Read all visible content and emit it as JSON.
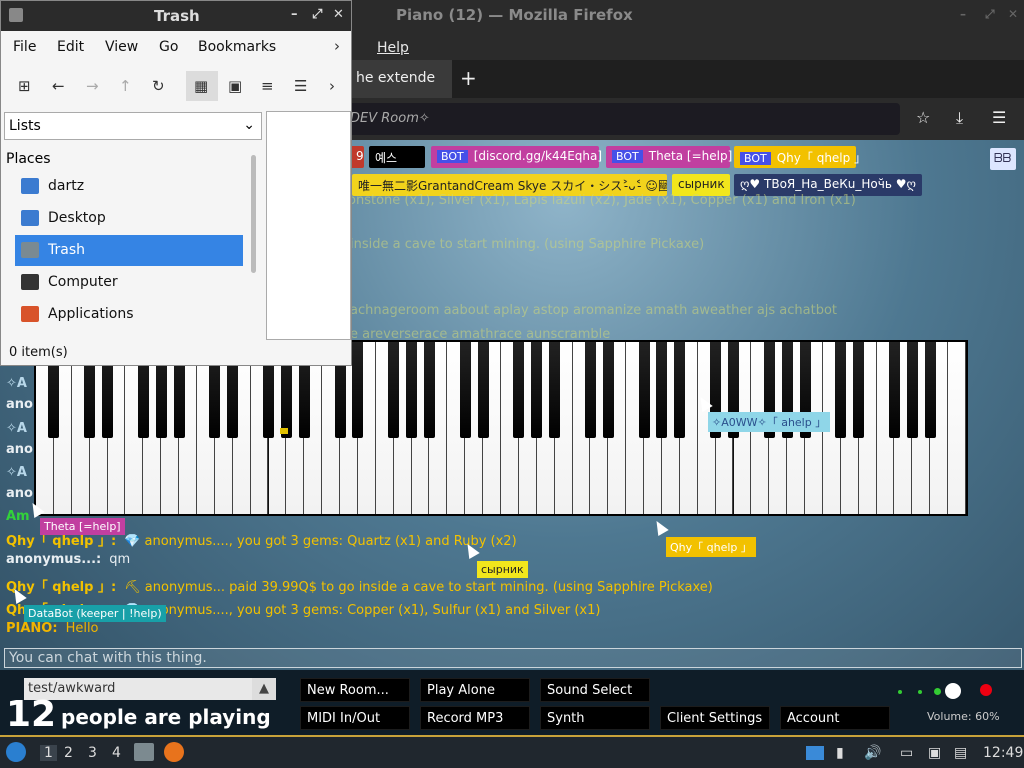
{
  "firefox": {
    "title": "Piano (12) — Mozilla Firefox",
    "menu_help": "Help",
    "tab_title": "he extende",
    "new_tab_icon": "+",
    "url_text": "DEV Room✧"
  },
  "tags_top": [
    {
      "text": "9",
      "bg": "#c0392b",
      "fg": "#fff"
    },
    {
      "text": "예스",
      "bg": "#000000",
      "fg": "#fff"
    },
    {
      "text": "[discord.gg/k44Eqha]",
      "bot": "BOT",
      "bg": "#c13fa0",
      "fg": "#fff"
    },
    {
      "text": "Theta [=help]",
      "bot": "BOT",
      "bg": "#c13fa0",
      "fg": "#fff"
    },
    {
      "text": "Qhy「 qhelp 」",
      "bot": "BOT",
      "bg": "#f2c100",
      "fg": "#fff"
    }
  ],
  "tags_second": [
    {
      "text": "唯一無二影GrantandCream Skye スカイ・シス˃̵ᴗ˂̵ ☺圝",
      "bg": "#f2d31c",
      "fg": "#222"
    },
    {
      "text": "сырник",
      "bg": "#f2e61c",
      "fg": "#222"
    },
    {
      "text": "ღ♥ ТВоЯ_На_ВеКu_Ноч̆ь ♥ღ",
      "bg": "#2a3a68",
      "fg": "#fff"
    }
  ],
  "faded_lines": [
    "onstone (x1), Silver (x1), Lapis lazuli (x2), Jade (x1), Copper (x1) and Iron (x1)",
    "inside a cave to start mining. (using Sapphire Pickaxe)",
    "achnageroom aabout aplay astop aromanize amath aweather ajs achatbot",
    "e areverserace amathrace aunscramble"
  ],
  "left_fragments": [
    "✧A",
    "ano",
    "✧A",
    "ano",
    "✧A",
    "ano",
    "Am"
  ],
  "chat": [
    {
      "name": "Qhy「 qhelp 」:",
      "name_color": "#f2c100",
      "text": "💎 anonymus...., you got 3 gems: Quartz (x1) and Ruby (x2)",
      "text_color": "#f2c100"
    },
    {
      "name": "anonymus...:",
      "name_color": "#e8eef2",
      "text": "qm",
      "text_color": "#e8eef2"
    },
    {
      "name": "Qhy「 qhelp 」:",
      "name_color": "#f2c100",
      "text": "⛏ anonymus... paid 39.99Q$ to go inside a cave to start mining. (using Sapphire Pickaxe)",
      "text_color": "#f2c100"
    },
    {
      "name": "Qhy「 qhelp 」:",
      "name_color": "#f2c100",
      "text": "💎 anonymus...., you got 3 gems: Copper (x1), Sulfur (x1) and Silver (x1)",
      "text_color": "#f2c100"
    },
    {
      "name": "PIANO:",
      "name_color": "#f0b500",
      "text": "Hello",
      "text_color": "#f0b500"
    }
  ],
  "cursor_labels": [
    {
      "text": "✧A0WW✧「 ahelp 」",
      "bg": "#8fd6e8",
      "fg": "#2a4f8c"
    },
    {
      "text": "Theta [=help]",
      "bg": "#c13fa0",
      "fg": "#fff"
    },
    {
      "text": "Qhy「 qhelp 」",
      "bg": "#f2c100",
      "fg": "#fff"
    },
    {
      "text": "сырник",
      "bg": "#f2e61c",
      "fg": "#222"
    },
    {
      "text": "DataBot (keeper | !help)",
      "bg": "#18a0a8",
      "fg": "#fff"
    }
  ],
  "chat_placeholder": "You can chat with this thing.",
  "room_input": "test/awkward",
  "player_count": "12",
  "player_count_label": "people are playing",
  "buttons": [
    "New Room...",
    "Play Alone",
    "Sound Select",
    "MIDI In/Out",
    "Record MP3",
    "Synth",
    "Client Settings",
    "Account"
  ],
  "volume": "Volume: 60%",
  "trash": {
    "title": "Trash",
    "menu": [
      "File",
      "Edit",
      "View",
      "Go",
      "Bookmarks"
    ],
    "combo": "Lists",
    "places_header": "Places",
    "places": [
      {
        "label": "dartz",
        "icon": "home-folder-icon"
      },
      {
        "label": "Desktop",
        "icon": "desktop-icon"
      },
      {
        "label": "Trash",
        "icon": "trash-icon",
        "selected": true
      },
      {
        "label": "Computer",
        "icon": "computer-icon"
      },
      {
        "label": "Applications",
        "icon": "applications-icon"
      }
    ],
    "status": "0 item(s)"
  },
  "taskbar": {
    "workspaces": [
      "1",
      "2",
      "3",
      "4"
    ],
    "clock": "12:49"
  }
}
